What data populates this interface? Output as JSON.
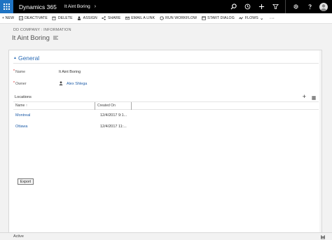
{
  "app": {
    "name": "Dynamics 365",
    "breadcrumb": "It Aint Boring"
  },
  "nav_icons": [
    "search-icon",
    "history-icon",
    "plus-icon",
    "filter-icon",
    "gear-icon",
    "help-icon",
    "avatar"
  ],
  "commands": [
    {
      "label": "+ NEW",
      "icon": "plus-icon"
    },
    {
      "label": "DEACTIVATE",
      "icon": "deactivate-icon"
    },
    {
      "label": "DELETE",
      "icon": "trash-icon"
    },
    {
      "label": "ASSIGN",
      "icon": "assign-icon"
    },
    {
      "label": "SHARE",
      "icon": "share-icon"
    },
    {
      "label": "EMAIL A LINK",
      "icon": "mail-icon"
    },
    {
      "label": "RUN WORKFLOW",
      "icon": "workflow-icon"
    },
    {
      "label": "START DIALOG",
      "icon": "dialog-icon"
    },
    {
      "label": "FLOWS",
      "icon": "flows-icon"
    }
  ],
  "header": {
    "entity": "DD COMPANY : INFORMATION",
    "title": "It Aint Boring"
  },
  "form": {
    "section_title": "General",
    "fields": [
      {
        "label": "Name",
        "value": "It Aint Boring",
        "required": true
      },
      {
        "label": "Owner",
        "value": "Alex Shlega",
        "required": true
      }
    ]
  },
  "subgrid": {
    "title": "Locations",
    "columns": [
      "Name ↑",
      "Created On"
    ],
    "rows": [
      {
        "name": "Montreal",
        "created": "12/4/2017 9:1..."
      },
      {
        "name": "Ottawa",
        "created": "12/4/2017 11:..."
      }
    ]
  },
  "export_label": "Export",
  "status": "Active",
  "colors": {
    "brand_blue": "#1f73c2",
    "link": "#1f5da8",
    "section": "#2a6bb5"
  }
}
